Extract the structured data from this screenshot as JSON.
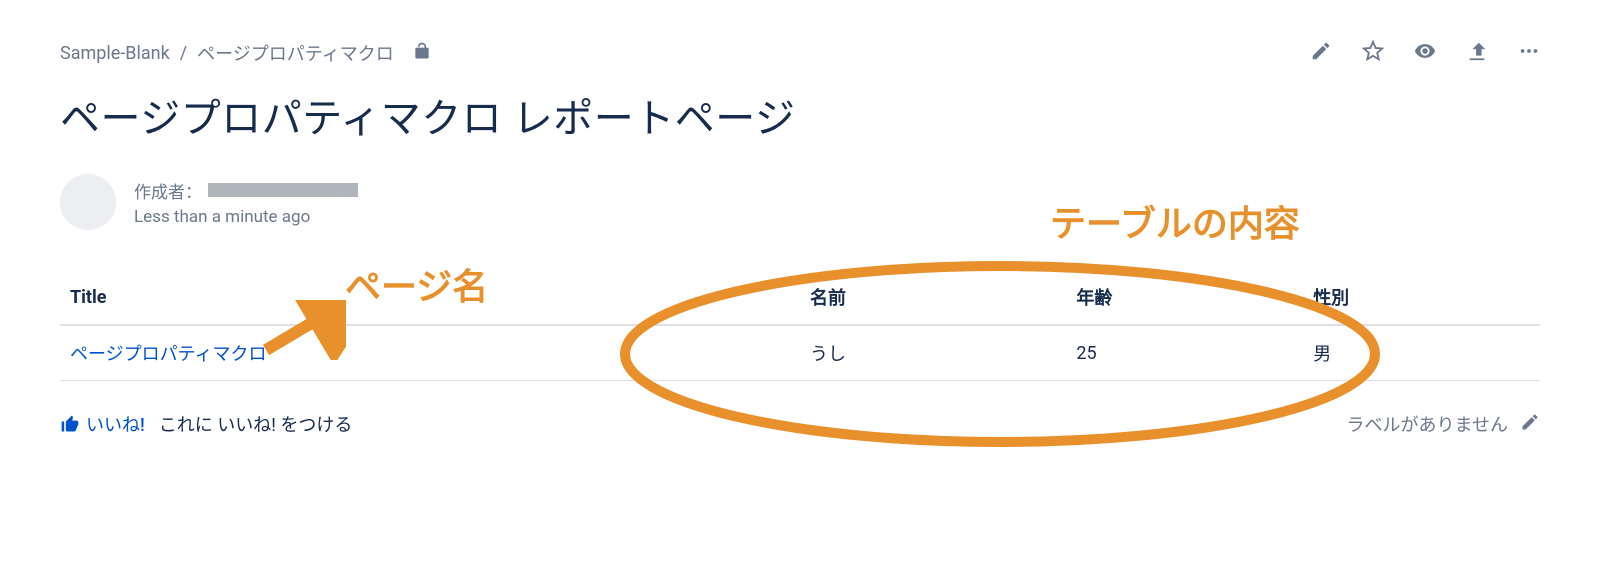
{
  "breadcrumbs": {
    "space": "Sample-Blank",
    "parent": "ページプロパティマクロ"
  },
  "page": {
    "title": "ページプロパティマクロ レポートページ"
  },
  "author": {
    "label": "作成者：",
    "timestamp": "Less than a minute ago"
  },
  "table": {
    "headers": {
      "title": "Title",
      "name": "名前",
      "age": "年齢",
      "sex": "性別"
    },
    "rows": [
      {
        "title": "ページプロパティマクロ",
        "name": "うし",
        "age": "25",
        "sex": "男"
      }
    ]
  },
  "footer": {
    "like_label": "いいね!",
    "like_prompt": "これに いいね! をつける",
    "no_labels": "ラベルがありません"
  },
  "annotations": {
    "page_name": "ページ名",
    "table_content": "テーブルの内容"
  },
  "colors": {
    "accent": "#0052cc",
    "annotation": "#e8902b",
    "text": "#172b4d",
    "muted": "#6b778c"
  }
}
